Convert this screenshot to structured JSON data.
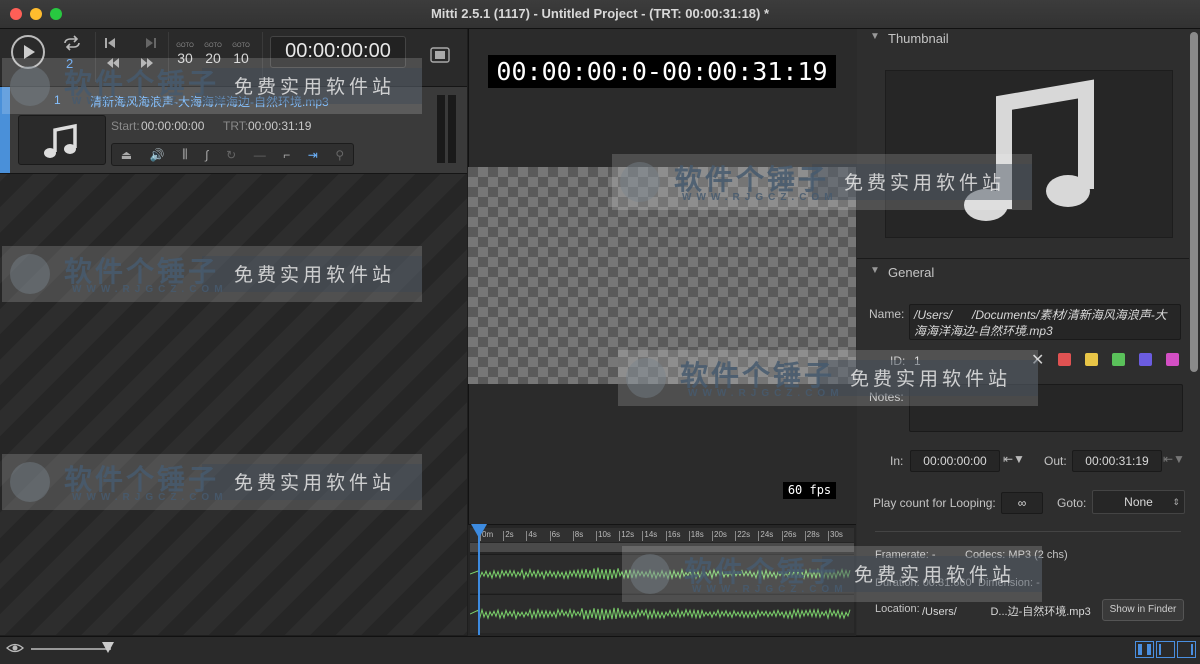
{
  "window": {
    "title": "Mitti 2.5.1 (1117) - Untitled Project - (TRT: 00:00:31:18) *"
  },
  "toolbar": {
    "loop_count": "2",
    "goto_label": "GOTO",
    "goto_values": [
      "30",
      "20",
      "10"
    ],
    "clock": "00:00:00:00"
  },
  "cue": {
    "number": "1",
    "name": "清新海风海浪声-大海海洋海边-自然环境.mp3",
    "start_label": "Start:",
    "start": "00:00:00:00",
    "trt_label": "TRT:",
    "trt": "00:00:31:19"
  },
  "preview": {
    "timecode": "00:00:00:0-00:00:31:19",
    "fps": "60 fps"
  },
  "timeline": {
    "ticks": [
      "0m",
      "2s",
      "4s",
      "6s",
      "8s",
      "10s",
      "12s",
      "14s",
      "16s",
      "18s",
      "20s",
      "22s",
      "24s",
      "26s",
      "28s",
      "30s"
    ]
  },
  "inspector": {
    "thumbnail_header": "Thumbnail",
    "general_header": "General",
    "name_label": "Name:",
    "name_value": "/Users/      /Documents/素材/清新海风海浪声-大海海洋海边-自然环境.mp3",
    "id_label": "ID:",
    "id_value": "1",
    "notes_label": "Notes:",
    "in_label": "In:",
    "in_value": "00:00:00:00",
    "out_label": "Out:",
    "out_value": "00:00:31:19",
    "loop_label": "Play count for Looping:",
    "loop_value": "∞",
    "goto_label": "Goto:",
    "goto_value": "None",
    "framerate": "Framerate: -",
    "codecs": "Codecs: MP3 (2 chs)",
    "duration": "Duration: 00:31.660",
    "dimension": "Dimension: -",
    "location_label": "Location:",
    "location_value": "/Users/           D...边-自然环境.mp3",
    "show_in_finder": "Show in Finder",
    "colors": [
      "#e05252",
      "#e8c547",
      "#5ac15a",
      "#6b5ce0",
      "#d34fc4"
    ]
  },
  "watermark": {
    "cn": "软件个锤子",
    "en": "WWW.RJGCZ.COM",
    "slogan": "免费实用软件站"
  }
}
